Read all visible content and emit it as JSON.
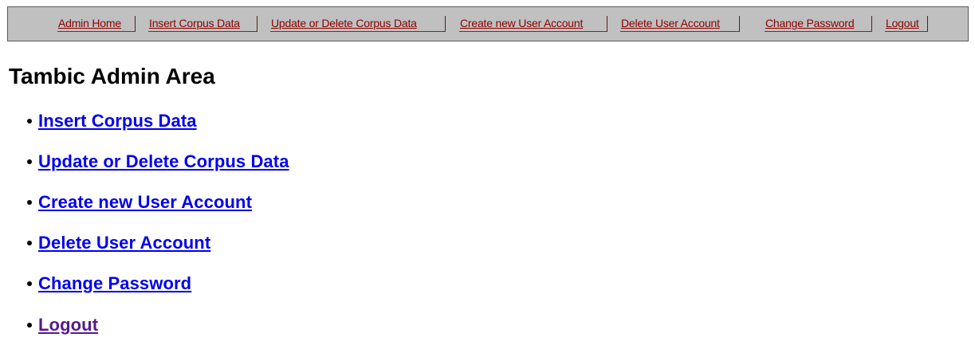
{
  "nav": {
    "items": [
      {
        "label": "Admin Home"
      },
      {
        "label": "Insert Corpus Data"
      },
      {
        "label": "Update or Delete Corpus Data"
      },
      {
        "label": "Create new User Account"
      },
      {
        "label": "Delete User Account"
      },
      {
        "label": "Change Password"
      },
      {
        "label": "Logout"
      }
    ]
  },
  "page": {
    "title": "Tambic Admin Area"
  },
  "links": [
    {
      "label": "Insert Corpus Data",
      "state": "unvisited"
    },
    {
      "label": "Update or Delete Corpus Data",
      "state": "unvisited"
    },
    {
      "label": "Create new User Account",
      "state": "unvisited"
    },
    {
      "label": "Delete User Account",
      "state": "unvisited"
    },
    {
      "label": "Change Password",
      "state": "unvisited"
    },
    {
      "label": "Logout",
      "state": "visited"
    }
  ],
  "colors": {
    "nav_background": "#c0c0c0",
    "nav_link": "#8b0000",
    "link": "#0000ee",
    "visited_link": "#551a8b"
  }
}
